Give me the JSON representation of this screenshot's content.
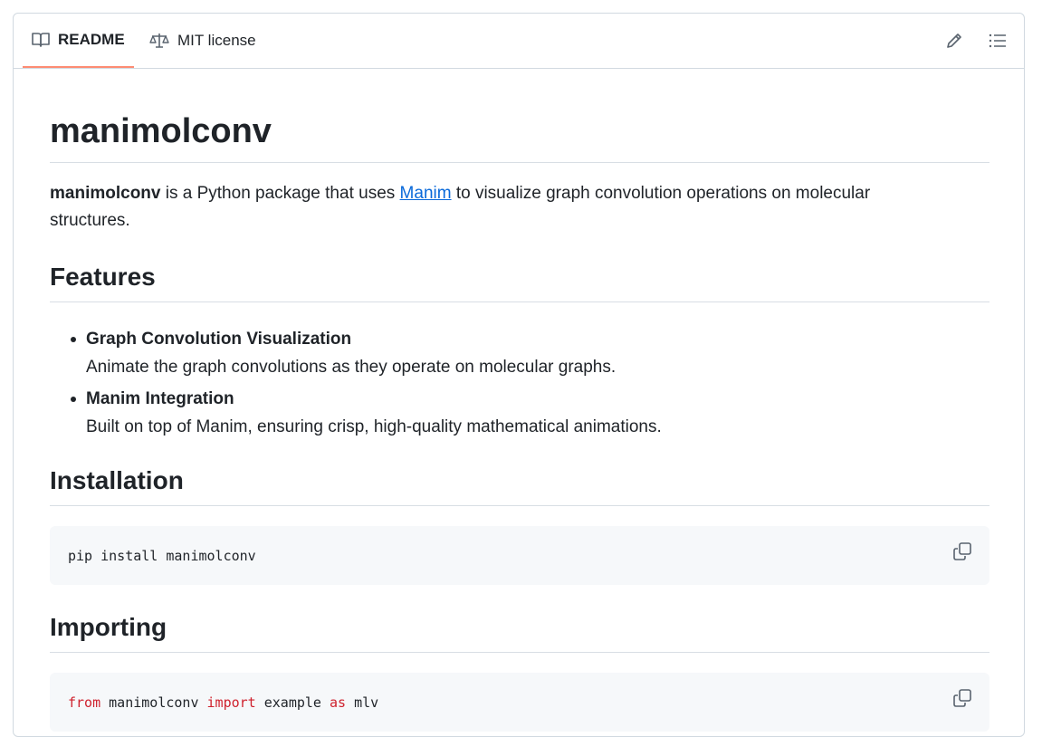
{
  "tabs": [
    {
      "label": "README",
      "icon": "book-icon",
      "active": true
    },
    {
      "label": "MIT license",
      "icon": "law-icon",
      "active": false
    }
  ],
  "toolbar": {
    "edit_icon": "pencil-icon",
    "outline_icon": "list-icon"
  },
  "readme": {
    "title": "manimolconv",
    "intro": {
      "bold": "manimolconv",
      "before_link": " is a Python package that uses ",
      "link": "Manim",
      "after_link": " to visualize graph convolution operations on molecular structures."
    },
    "features_heading": "Features",
    "features": [
      {
        "title": "Graph Convolution Visualization",
        "desc": "Animate the graph convolutions as they operate on molecular graphs."
      },
      {
        "title": "Manim Integration",
        "desc": "Built on top of Manim, ensuring crisp, high-quality mathematical animations."
      }
    ],
    "installation_heading": "Installation",
    "install_code": "pip install manimolconv",
    "importing_heading": "Importing",
    "import_code": {
      "kw1": "from",
      "mod": " manimolconv ",
      "kw2": "import",
      "name": " example ",
      "kw3": "as",
      "alias": " mlv"
    }
  },
  "colors": {
    "accent_tab": "#fd8c73",
    "link": "#0969da",
    "keyword": "#cf222e",
    "code_bg": "#f6f8fa"
  }
}
